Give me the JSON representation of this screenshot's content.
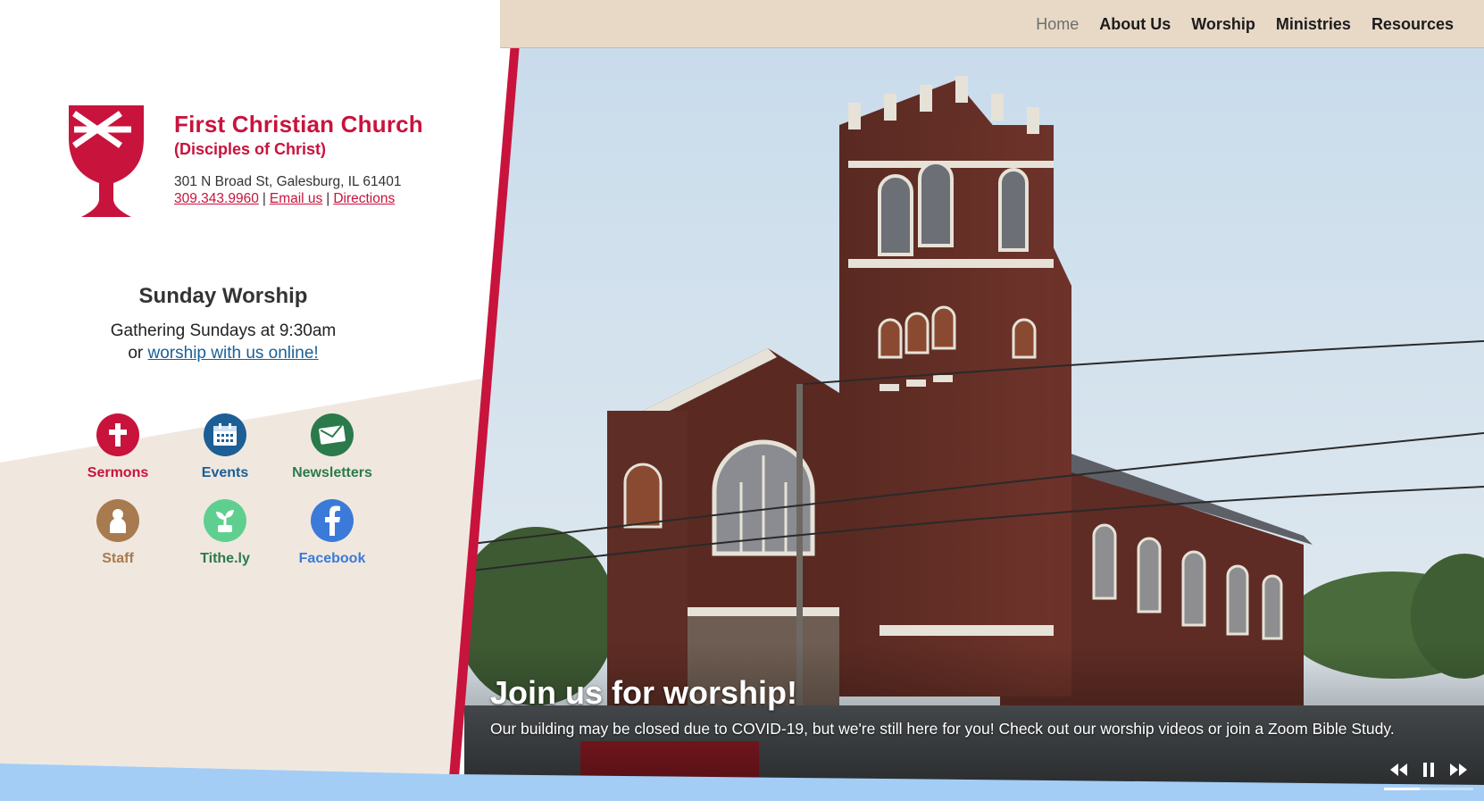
{
  "nav": {
    "items": [
      {
        "label": "Home",
        "active": true
      },
      {
        "label": "About Us",
        "active": false
      },
      {
        "label": "Worship",
        "active": false
      },
      {
        "label": "Ministries",
        "active": false
      },
      {
        "label": "Resources",
        "active": false
      }
    ]
  },
  "church": {
    "name": "First Christian Church",
    "subtitle": "(Disciples of Christ)",
    "address": "301 N Broad St, Galesburg, IL 61401",
    "phone": "309.343.9960",
    "email_label": "Email us",
    "directions_label": "Directions",
    "separator": "|"
  },
  "worship": {
    "title": "Sunday Worship",
    "time": "Gathering Sundays at 9:30am",
    "or": "or",
    "online_link": "worship with us online!"
  },
  "quick_links": [
    {
      "label": "Sermons",
      "icon": "cross-icon",
      "color": "#c8133d"
    },
    {
      "label": "Events",
      "icon": "calendar-icon",
      "color": "#1b5f96"
    },
    {
      "label": "Newsletters",
      "icon": "envelope-icon",
      "color": "#2b7a4b"
    },
    {
      "label": "Staff",
      "icon": "person-icon",
      "color": "#a87a4f"
    },
    {
      "label": "Tithe.ly",
      "icon": "sprout-icon",
      "color": "#2b7a4b"
    },
    {
      "label": "Facebook",
      "icon": "facebook-icon",
      "color": "#3b7ad8"
    }
  ],
  "slide": {
    "title": "Join us for worship!",
    "text": "Our building may be closed due to COVID-19, but we're still here for you! Check out our worship videos or join a Zoom Bible Study.",
    "progress": 0.4
  },
  "colors": {
    "accent": "#c8133d",
    "nav_bg": "#e8d9c6",
    "panel_bg": "#f0e8df",
    "footer_blue": "#a3cdf5"
  }
}
